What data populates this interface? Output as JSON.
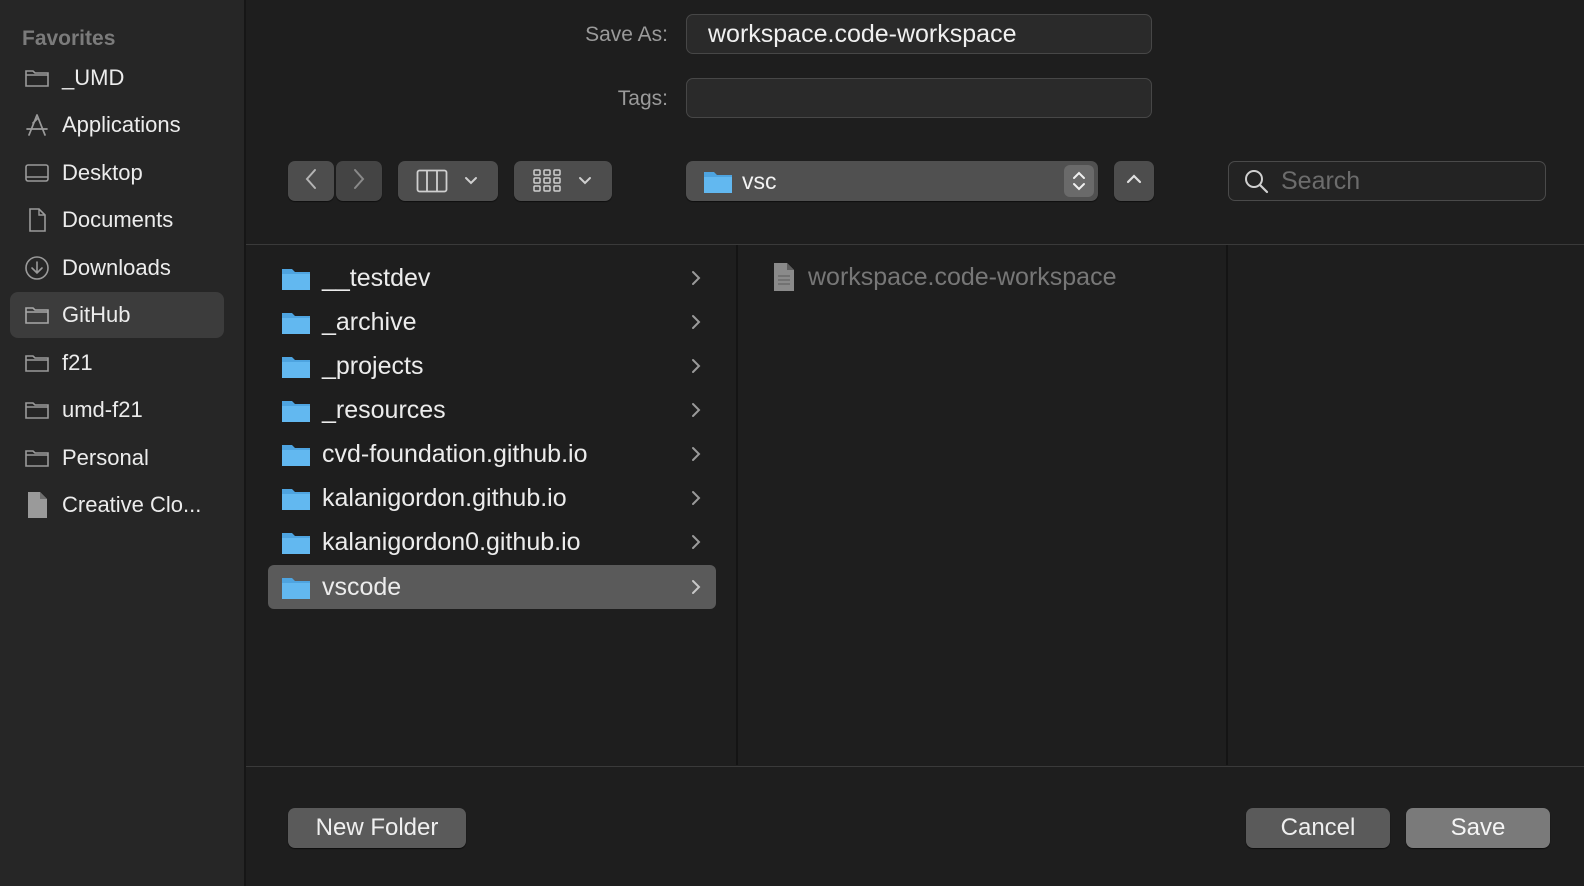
{
  "sidebar": {
    "header": "Favorites",
    "items": [
      {
        "label": "_UMD",
        "icon": "folder-icon"
      },
      {
        "label": "Applications",
        "icon": "applications-icon"
      },
      {
        "label": "Desktop",
        "icon": "desktop-icon"
      },
      {
        "label": "Documents",
        "icon": "document-icon"
      },
      {
        "label": "Downloads",
        "icon": "download-icon"
      },
      {
        "label": "GitHub",
        "icon": "folder-icon",
        "selected": true
      },
      {
        "label": "f21",
        "icon": "folder-icon"
      },
      {
        "label": "umd-f21",
        "icon": "folder-icon"
      },
      {
        "label": "Personal",
        "icon": "folder-icon"
      },
      {
        "label": "Creative Clo...",
        "icon": "file-icon"
      }
    ]
  },
  "form": {
    "save_as_label": "Save As:",
    "save_as_value": "workspace.code-workspace",
    "tags_label": "Tags:",
    "tags_value": ""
  },
  "toolbar": {
    "location": "vsc",
    "search_placeholder": "Search"
  },
  "browser": {
    "column1": [
      {
        "label": "__testdev"
      },
      {
        "label": "_archive"
      },
      {
        "label": "_projects"
      },
      {
        "label": "_resources"
      },
      {
        "label": "cvd-foundation.github.io"
      },
      {
        "label": "kalanigordon.github.io"
      },
      {
        "label": "kalanigordon0.github.io"
      },
      {
        "label": "vscode",
        "selected": true
      }
    ],
    "column2": [
      {
        "label": "workspace.code-workspace"
      }
    ]
  },
  "buttons": {
    "new_folder": "New Folder",
    "cancel": "Cancel",
    "save": "Save"
  },
  "colors": {
    "folder_blue": "#5ab0ea",
    "background": "#1e1e1e",
    "sidebar": "#262626"
  }
}
